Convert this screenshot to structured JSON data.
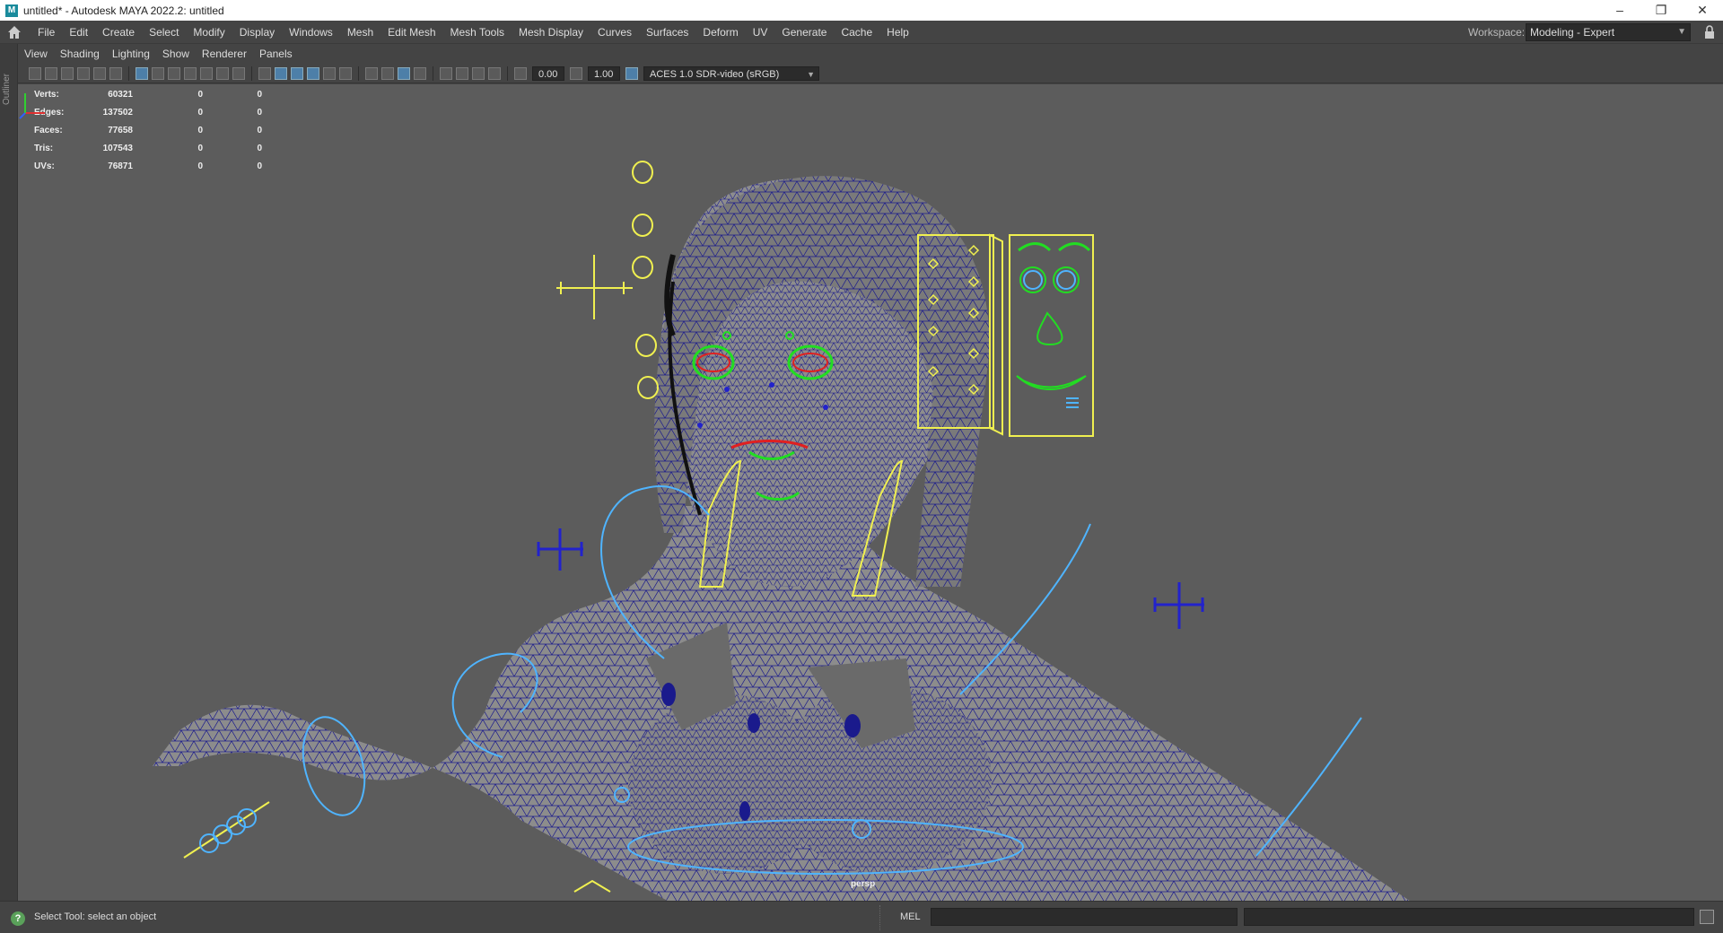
{
  "window": {
    "title": "untitled* - Autodesk MAYA 2022.2: untitled",
    "app_icon": "M",
    "controls": [
      "–",
      "❐",
      "✕"
    ]
  },
  "menubar": {
    "items": [
      "File",
      "Edit",
      "Create",
      "Select",
      "Modify",
      "Display",
      "Windows",
      "Mesh",
      "Edit Mesh",
      "Mesh Tools",
      "Mesh Display",
      "Curves",
      "Surfaces",
      "Deform",
      "UV",
      "Generate",
      "Cache",
      "Help"
    ],
    "workspace_label": "Workspace:",
    "workspace_value": "Modeling - Expert"
  },
  "sidebar": {
    "outliner_label": "Outliner"
  },
  "panel_menu": [
    "View",
    "Shading",
    "Lighting",
    "Show",
    "Renderer",
    "Panels"
  ],
  "panel_toolbar": {
    "exposure": "0.00",
    "gamma": "1.00",
    "color_space": "ACES 1.0 SDR-video (sRGB)"
  },
  "hud": {
    "rows": [
      {
        "label": "Verts:",
        "value": "60321",
        "sel": "0",
        "comp": "0"
      },
      {
        "label": "Edges:",
        "value": "137502",
        "sel": "0",
        "comp": "0"
      },
      {
        "label": "Faces:",
        "value": "77658",
        "sel": "0",
        "comp": "0"
      },
      {
        "label": "Tris:",
        "value": "107543",
        "sel": "0",
        "comp": "0"
      },
      {
        "label": "UVs:",
        "value": "76871",
        "sel": "0",
        "comp": "0"
      }
    ]
  },
  "viewport": {
    "camera": "persp",
    "colors": {
      "background": "#5c5c5c",
      "mesh": "#8a8a8a",
      "wire": "#1a1a8c",
      "rig_yellow": "#f0f050",
      "rig_cyan": "#4fb4ff",
      "rig_green": "#22dd22",
      "rig_red": "#e02020",
      "rig_blue": "#2222cc"
    }
  },
  "statusbar": {
    "help_icon": "?",
    "message": "Select Tool: select an object",
    "mel_label": "MEL"
  }
}
